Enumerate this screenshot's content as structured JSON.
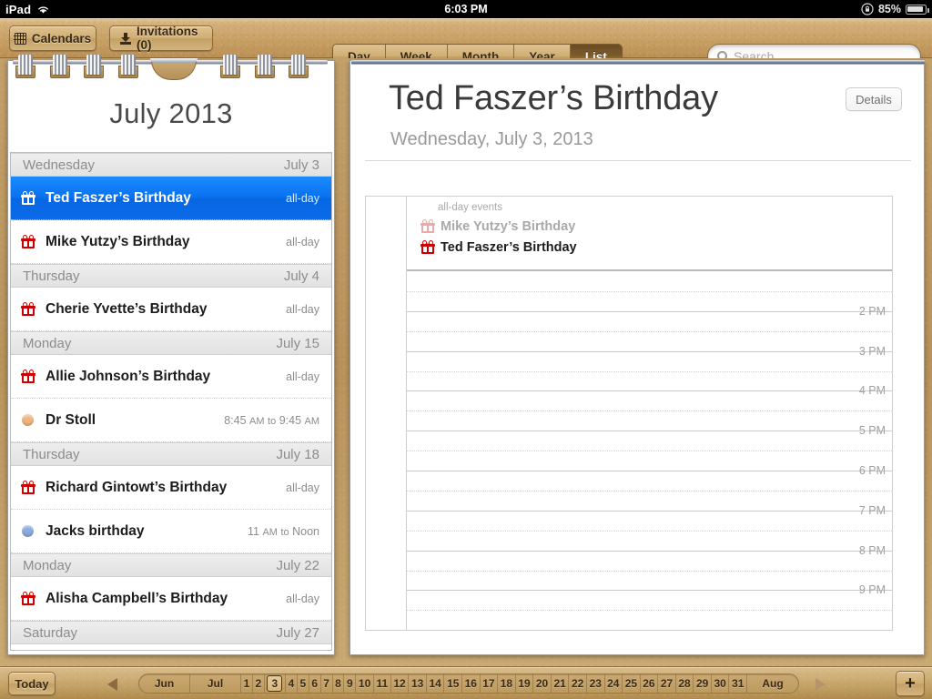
{
  "status_bar": {
    "device": "iPad",
    "wifi_icon": "wifi-icon",
    "time": "6:03 PM",
    "rotation_lock_icon": "rotation-lock-icon",
    "battery_percent": "85%"
  },
  "toolbar": {
    "calendars_label": "Calendars",
    "invitations_label": "Invitations (0)",
    "views": [
      {
        "label": "Day",
        "selected": false
      },
      {
        "label": "Week",
        "selected": false
      },
      {
        "label": "Month",
        "selected": false
      },
      {
        "label": "Year",
        "selected": false
      },
      {
        "label": "List",
        "selected": true
      }
    ],
    "search": {
      "placeholder": "Search",
      "value": ""
    }
  },
  "left_panel": {
    "month_title": "July 2013",
    "rows": [
      {
        "kind": "day",
        "weekday": "Wednesday",
        "date": "July 3"
      },
      {
        "kind": "event",
        "badge": "gift",
        "badge_color": "#ffffff",
        "title": "Ted Faszer’s Birthday",
        "time": "all-day",
        "selected": true
      },
      {
        "kind": "event",
        "badge": "gift",
        "badge_color": "#cc0000",
        "title": "Mike Yutzy’s Birthday",
        "time": "all-day",
        "selected": false
      },
      {
        "kind": "day",
        "weekday": "Thursday",
        "date": "July 4"
      },
      {
        "kind": "event",
        "badge": "gift",
        "badge_color": "#cc0000",
        "title": "Cherie Yvette’s Birthday",
        "time": "all-day",
        "selected": false
      },
      {
        "kind": "day",
        "weekday": "Monday",
        "date": "July 15"
      },
      {
        "kind": "event",
        "badge": "gift",
        "badge_color": "#cc0000",
        "title": "Allie Johnson’s Birthday",
        "time": "all-day",
        "selected": false
      },
      {
        "kind": "event",
        "badge": "dot",
        "badge_color": "#f2b57e",
        "title": "Dr Stoll",
        "time": "8:45 AM to 9:45 AM",
        "selected": false
      },
      {
        "kind": "day",
        "weekday": "Thursday",
        "date": "July 18"
      },
      {
        "kind": "event",
        "badge": "gift",
        "badge_color": "#cc0000",
        "title": "Richard Gintowt’s Birthday",
        "time": "all-day",
        "selected": false
      },
      {
        "kind": "event",
        "badge": "dot",
        "badge_color": "#8cabe0",
        "title": "Jacks birthday",
        "time": "11 AM to Noon",
        "selected": false
      },
      {
        "kind": "day",
        "weekday": "Monday",
        "date": "July 22"
      },
      {
        "kind": "event",
        "badge": "gift",
        "badge_color": "#cc0000",
        "title": "Alisha Campbell’s Birthday",
        "time": "all-day",
        "selected": false
      },
      {
        "kind": "day",
        "weekday": "Saturday",
        "date": "July 27"
      }
    ]
  },
  "right_panel": {
    "event_title": "Ted Faszer’s Birthday",
    "event_date": "Wednesday, July 3, 2013",
    "details_label": "Details",
    "all_day_label": "all-day events",
    "all_day_events": [
      {
        "title": "Mike Yutzy’s Birthday",
        "badge": "gift",
        "dimmed": true
      },
      {
        "title": "Ted Faszer’s Birthday",
        "badge": "gift",
        "dimmed": false
      }
    ],
    "hours": [
      "2 PM",
      "3 PM",
      "4 PM",
      "5 PM",
      "6 PM",
      "7 PM",
      "8 PM",
      "9 PM"
    ]
  },
  "bottom_bar": {
    "today_label": "Today",
    "prev_icon": "arrow-left-icon",
    "next_icon": "arrow-right-icon",
    "add_label": "+",
    "strip": [
      {
        "label": "Jun",
        "type": "month",
        "current": false
      },
      {
        "label": "Jul",
        "type": "month",
        "current": false
      },
      {
        "label": "1",
        "type": "day",
        "current": false
      },
      {
        "label": "2",
        "type": "day",
        "current": false
      },
      {
        "label": "3",
        "type": "day",
        "current": true
      },
      {
        "label": "4",
        "type": "day",
        "current": false
      },
      {
        "label": "5",
        "type": "day",
        "current": false
      },
      {
        "label": "6",
        "type": "day",
        "current": false
      },
      {
        "label": "7",
        "type": "day",
        "current": false
      },
      {
        "label": "8",
        "type": "day",
        "current": false
      },
      {
        "label": "9",
        "type": "day",
        "current": false
      },
      {
        "label": "10",
        "type": "day",
        "current": false
      },
      {
        "label": "11",
        "type": "day",
        "current": false
      },
      {
        "label": "12",
        "type": "day",
        "current": false
      },
      {
        "label": "13",
        "type": "day",
        "current": false
      },
      {
        "label": "14",
        "type": "day",
        "current": false
      },
      {
        "label": "15",
        "type": "day",
        "current": false
      },
      {
        "label": "16",
        "type": "day",
        "current": false
      },
      {
        "label": "17",
        "type": "day",
        "current": false
      },
      {
        "label": "18",
        "type": "day",
        "current": false
      },
      {
        "label": "19",
        "type": "day",
        "current": false
      },
      {
        "label": "20",
        "type": "day",
        "current": false
      },
      {
        "label": "21",
        "type": "day",
        "current": false
      },
      {
        "label": "22",
        "type": "day",
        "current": false
      },
      {
        "label": "23",
        "type": "day",
        "current": false
      },
      {
        "label": "24",
        "type": "day",
        "current": false
      },
      {
        "label": "25",
        "type": "day",
        "current": false
      },
      {
        "label": "26",
        "type": "day",
        "current": false
      },
      {
        "label": "27",
        "type": "day",
        "current": false
      },
      {
        "label": "28",
        "type": "day",
        "current": false
      },
      {
        "label": "29",
        "type": "day",
        "current": false
      },
      {
        "label": "30",
        "type": "day",
        "current": false
      },
      {
        "label": "31",
        "type": "day",
        "current": false
      },
      {
        "label": "Aug",
        "type": "month",
        "current": false
      }
    ]
  }
}
